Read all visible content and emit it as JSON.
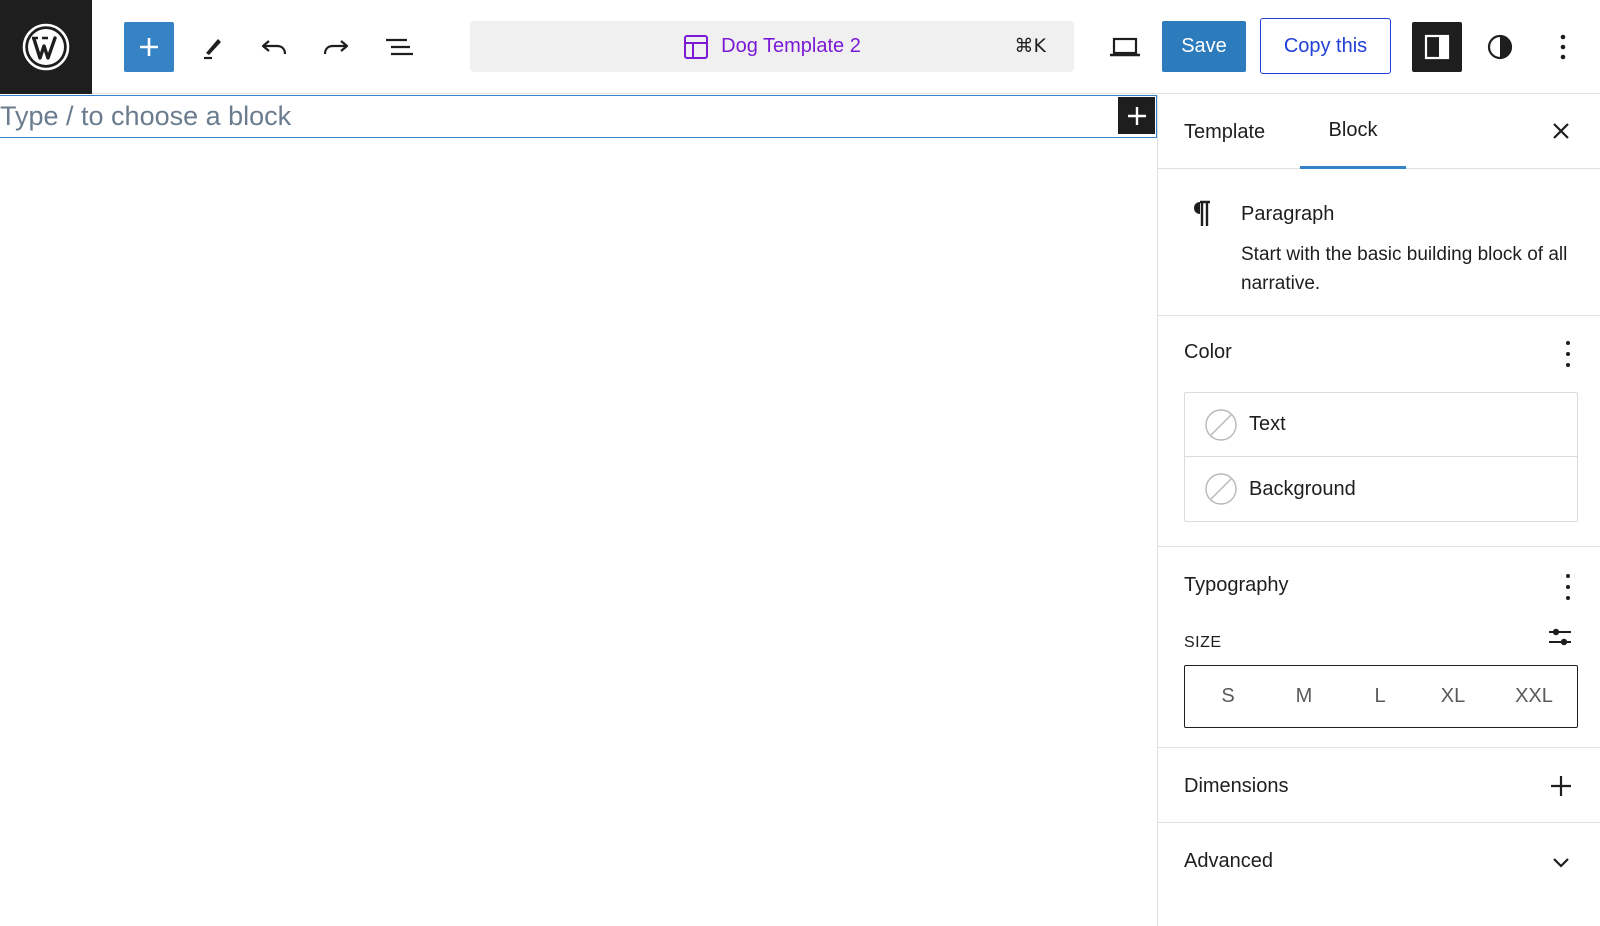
{
  "toolbar": {
    "document_title": "Dog Template 2",
    "shortcut": "⌘K",
    "save_label": "Save",
    "copy_label": "Copy this"
  },
  "editor": {
    "placeholder": "Type / to choose a block"
  },
  "sidebar": {
    "tabs": [
      {
        "label": "Template"
      },
      {
        "label": "Block",
        "active": true
      }
    ],
    "block_card": {
      "title": "Paragraph",
      "description": "Start with the basic building block of all narrative."
    },
    "color": {
      "title": "Color",
      "items": [
        {
          "label": "Text"
        },
        {
          "label": "Background"
        }
      ]
    },
    "typography": {
      "title": "Typography",
      "size_label": "SIZE",
      "sizes": [
        "S",
        "M",
        "L",
        "XL",
        "XXL"
      ]
    },
    "dimensions": {
      "title": "Dimensions"
    },
    "advanced": {
      "title": "Advanced"
    }
  },
  "colors": {
    "accent": "#3582c4",
    "save_bg": "#2c7bbd",
    "template_purple": "#7a1ad6",
    "copy_blue": "#2340d6",
    "dark": "#1e1e1e"
  }
}
